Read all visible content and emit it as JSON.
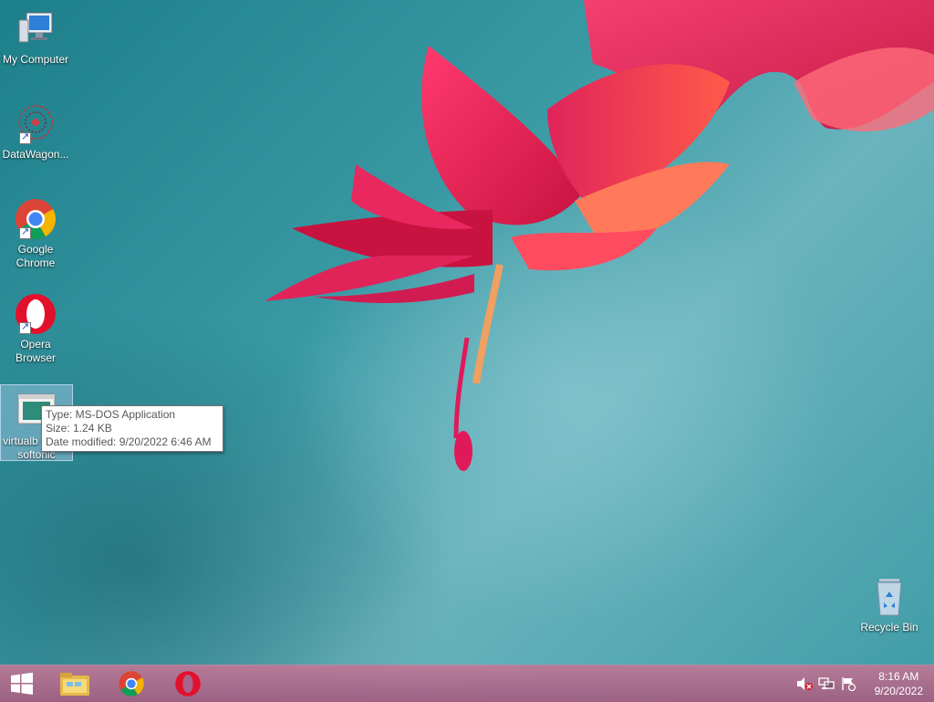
{
  "desktop": {
    "icons": [
      {
        "label": "My Computer",
        "icon": "computer-icon"
      },
      {
        "label": "DataWagon...",
        "icon": "datawagon-icon"
      },
      {
        "label": "Google Chrome",
        "icon": "chrome-icon"
      },
      {
        "label": "Opera Browser",
        "icon": "opera-icon"
      },
      {
        "label": "virtualb... softonic",
        "label_line1": "virtualb",
        "label_line2": "softonic",
        "icon": "msdos-app-icon",
        "selected": true
      },
      {
        "label": "Recycle Bin",
        "icon": "recycle-bin-icon"
      }
    ]
  },
  "tooltip": {
    "type": "Type: MS-DOS Application",
    "size": "Size: 1.24 KB",
    "date": "Date modified: 9/20/2022 6:46 AM"
  },
  "taskbar": {
    "pinned": [
      {
        "icon": "windows-start-icon"
      },
      {
        "icon": "file-explorer-icon"
      },
      {
        "icon": "chrome-icon"
      },
      {
        "icon": "opera-icon"
      }
    ],
    "tray": [
      {
        "icon": "volume-muted-icon"
      },
      {
        "icon": "network-icon"
      },
      {
        "icon": "action-center-flag-icon"
      }
    ],
    "clock": {
      "time": "8:16 AM",
      "date": "9/20/2022"
    }
  },
  "colors": {
    "taskbar": "#a8648a",
    "desktop": "#3a9aa4",
    "flower": "#e0245a"
  }
}
